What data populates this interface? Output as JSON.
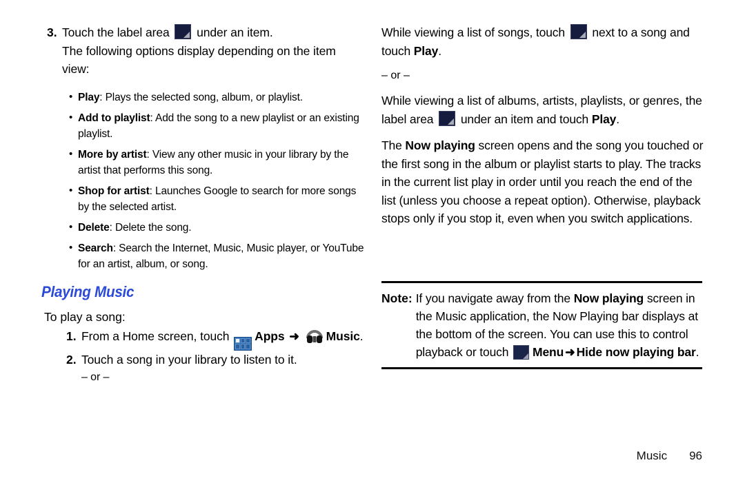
{
  "left_column": {
    "step3": {
      "number": "3.",
      "text_before_icon": "Touch the label area",
      "icon": "label-area-icon",
      "text_after_icon": "under an item.",
      "following_line1": "The following options display depending on the item",
      "following_line2": "view:"
    },
    "bullets": [
      {
        "term": "Play",
        "desc": ": Plays the selected song, album, or playlist."
      },
      {
        "term": "Add to playlist",
        "desc": ": Add the song to a new playlist or an existing playlist."
      },
      {
        "term": "More by artist",
        "desc": ": View any other music in your library by the artist that performs this song."
      },
      {
        "term": "Shop for artist",
        "desc": ": Launches Google to search for more songs by the selected artist."
      },
      {
        "term": "Delete",
        "desc": ": Delete the song."
      },
      {
        "term": "Search",
        "desc": ": Search the Internet, Music, Music player, or YouTube for an artist, album, or song."
      }
    ],
    "section_heading": "Playing Music",
    "lead_in": "To play a song:",
    "step1": {
      "number": "1.",
      "text_before_apps": "From a Home screen, touch",
      "apps_icon": "apps-grid-icon",
      "apps_label": "Apps",
      "arrow": "➜",
      "music_icon": "headphones-icon",
      "music_label": "Music",
      "period": "."
    },
    "step2": {
      "number": "2.",
      "text": "Touch a song in your library to listen to it.",
      "or": "– or –"
    }
  },
  "right_column": {
    "para1": {
      "before_icon": "While viewing a list of songs, touch",
      "icon": "label-area-icon",
      "after_icon": "next to a song",
      "line2_before_bold": "and touch ",
      "line2_bold": "Play",
      "line2_after_bold": "."
    },
    "or": "– or –",
    "para2": {
      "line1": "While viewing a list of albums, artists, playlists, or",
      "line2_before_icon": "genres, the label area",
      "icon": "label-area-icon",
      "line2_after_icon": "under an item and touch",
      "line3_bold": "Play",
      "line3_after": "."
    },
    "para3": {
      "before_bold": "The ",
      "bold": "Now playing",
      "after_bold": " screen opens and the song you touched or the first song in the album or playlist starts to play. The tracks in the current list play in order until you reach the end of the list (unless you choose a repeat option). Otherwise, playback stops only if you stop it, even when you switch applications."
    }
  },
  "note": {
    "label": "Note:",
    "seg1": "If you navigate away from the ",
    "bold1": "Now playing",
    "seg2": " screen in the Music application, the Now Playing bar displays at the bottom of the screen. You can use this to control playback or touch ",
    "menu_icon": "menu-icon",
    "bold2": "Menu",
    "arrow": "➜",
    "bold3": "Hide now playing bar",
    "seg3": "."
  },
  "footer": {
    "chapter": "Music",
    "page_number": "96"
  },
  "colors": {
    "heading_blue": "#2b4ad8",
    "icon_navy": "#151c3d",
    "apps_blue": "#2f6fb5",
    "text_black": "#161616"
  }
}
